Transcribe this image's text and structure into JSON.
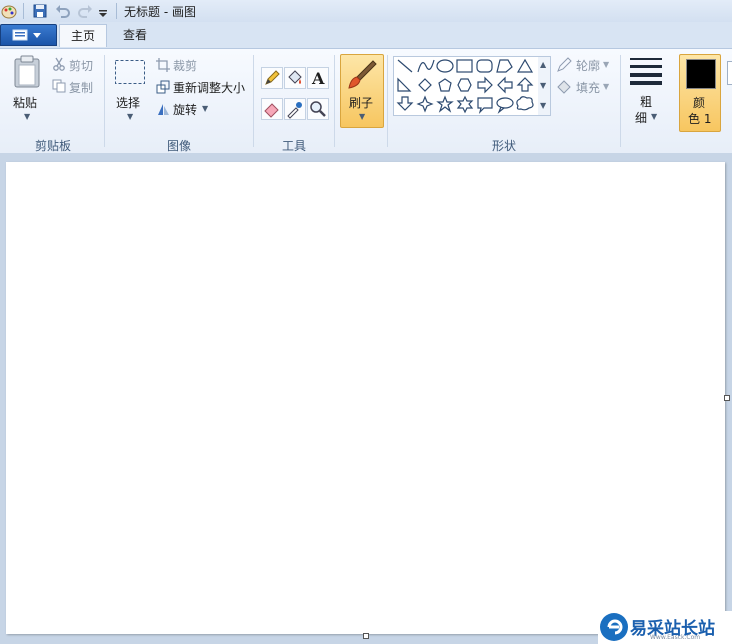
{
  "window": {
    "title": "无标题 - 画图"
  },
  "tabs": [
    {
      "label": "主页",
      "active": true
    },
    {
      "label": "查看",
      "active": false
    }
  ],
  "ribbon": {
    "clipboard": {
      "group_label": "剪贴板",
      "paste_label": "粘贴",
      "cut_label": "剪切",
      "copy_label": "复制"
    },
    "image": {
      "group_label": "图像",
      "select_label": "选择",
      "crop_label": "裁剪",
      "resize_label": "重新调整大小",
      "rotate_label": "旋转"
    },
    "tools": {
      "group_label": "工具"
    },
    "brushes": {
      "label": "刷子"
    },
    "shapes": {
      "group_label": "形状",
      "outline_label": "轮廓",
      "fill_label": "填充"
    },
    "size": {
      "label_line1": "粗",
      "label_line2": "细"
    },
    "color1": {
      "label_line1": "颜",
      "label_line2": "色 1",
      "value": "#000000"
    }
  },
  "watermark": {
    "text": "易采站长站",
    "url": "Www.Easck.Com"
  },
  "colors": {
    "accent": "#f7c660",
    "ribbon_bg": "#eef3fa",
    "canvas": "#ffffff",
    "workspace": "#c7d5e6"
  }
}
